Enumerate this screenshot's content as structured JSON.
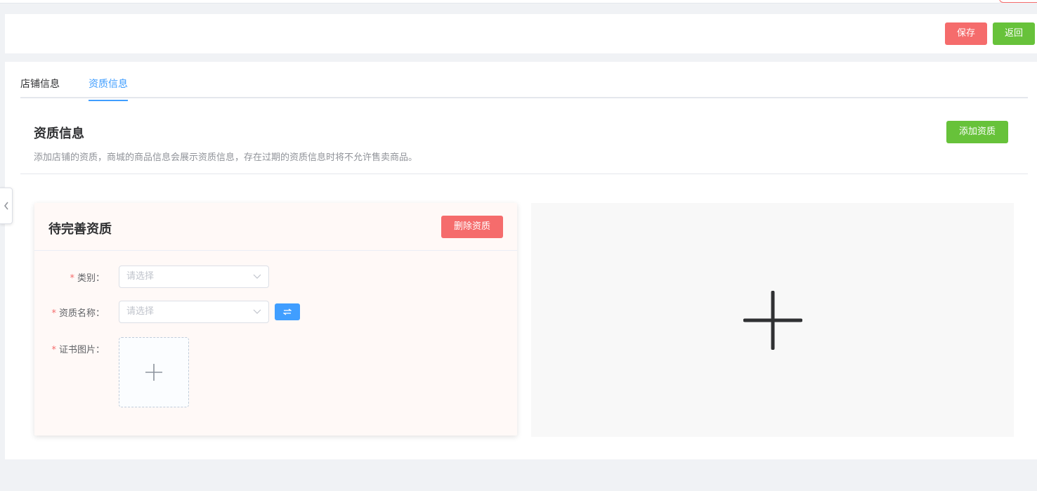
{
  "toolbar": {
    "save_label": "保存",
    "back_label": "返回"
  },
  "tabs": [
    {
      "label": "店铺信息",
      "active": false
    },
    {
      "label": "资质信息",
      "active": true
    }
  ],
  "section": {
    "title": "资质信息",
    "description": "添加店铺的资质，商城的商品信息会展示资质信息，存在过期的资质信息时将不允许售卖商品。",
    "add_button_label": "添加资质"
  },
  "qualification_card": {
    "title": "待完善资质",
    "delete_button_label": "删除资质",
    "fields": {
      "category": {
        "label": "类别：",
        "required": true,
        "placeholder": "请选择",
        "value": ""
      },
      "name": {
        "label": "资质名称：",
        "required": true,
        "placeholder": "请选择",
        "value": ""
      },
      "certificate": {
        "label": "证书图片：",
        "required": true
      }
    },
    "swap_icon": "swap-icon"
  },
  "add_panel": {
    "icon": "plus-icon"
  },
  "colors": {
    "primary": "#409eff",
    "success": "#67c23a",
    "danger": "#f56c6c",
    "background": "#f0f2f5"
  }
}
